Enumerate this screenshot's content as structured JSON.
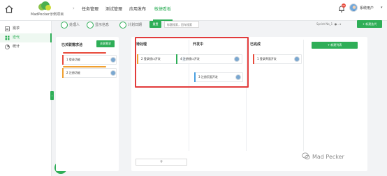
{
  "app": {
    "logo_text": "MadPecker示例项目"
  },
  "nav": {
    "tabs": [
      {
        "label": "任务管理"
      },
      {
        "label": "测试管理"
      },
      {
        "label": "应用发布"
      },
      {
        "label": "敏捷看板"
      }
    ],
    "active_index": 3
  },
  "header": {
    "notification_count": "99",
    "user_name": "系统用户"
  },
  "sidebar": {
    "items": [
      {
        "label": "需求",
        "icon": "requirement-icon"
      },
      {
        "label": "迭代",
        "icon": "iteration-icon"
      },
      {
        "label": "统计",
        "icon": "statistics-icon"
      }
    ],
    "active_index": 1
  },
  "toolbar": {
    "filters": [
      {
        "label": "处理人"
      },
      {
        "label": "显示信息"
      },
      {
        "label": "计划日期"
      }
    ],
    "reset_label": "重置",
    "search_placeholder": "标题搜索，回车搜索",
    "sprint_label": "Sprint No_1",
    "add_iteration_label": "+ 新建迭代"
  },
  "pool": {
    "title": "已关联需求池",
    "link_button": "关联需求",
    "cards": [
      {
        "text": "1 登录功能"
      },
      {
        "text": "2 注册功能"
      }
    ]
  },
  "board": {
    "columns": [
      {
        "title": "待处理",
        "cards": [
          {
            "text": "2 登录接口开发"
          }
        ]
      },
      {
        "title": "开发中",
        "cards": [
          {
            "text": "4 注册接口开发"
          },
          {
            "text": "3 注册页面开发"
          }
        ]
      },
      {
        "title": "已完成",
        "cards": [
          {
            "text": "1 登录界面开发"
          }
        ]
      }
    ],
    "new_column_label": "+ 新建列表",
    "add_button": "+"
  },
  "watermark": {
    "text": "Mad Pecker"
  },
  "colors": {
    "accent": "#2eae57",
    "highlight": "#e23b3b",
    "bar_red": "#e84b3c",
    "bar_orange": "#f0a030",
    "bar_green": "#2eae57",
    "bar_blue": "#4a9fe0"
  }
}
